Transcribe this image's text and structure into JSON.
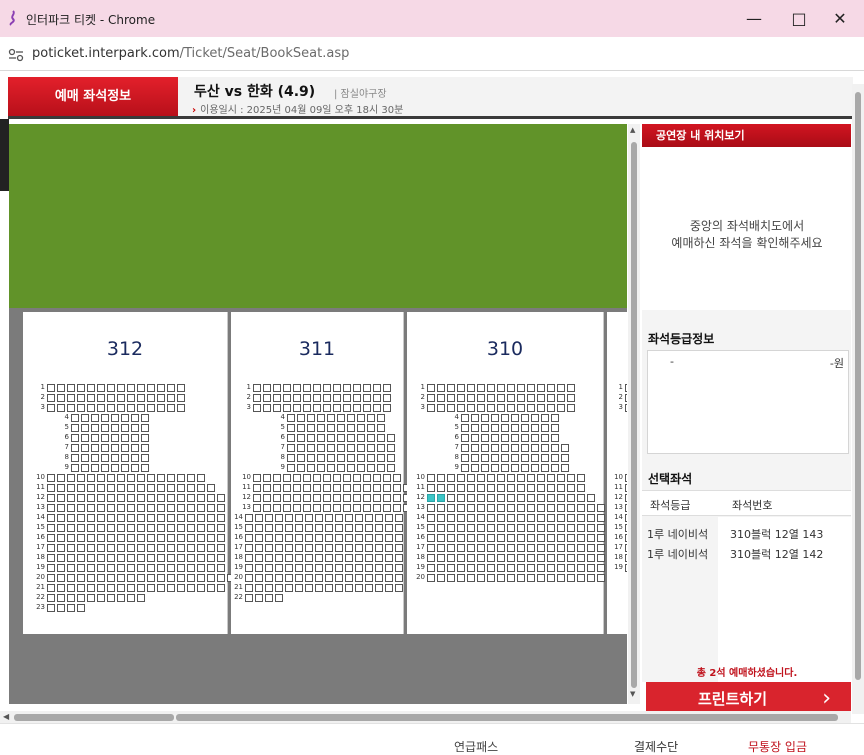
{
  "window": {
    "title": "인터파크 티켓 - Chrome",
    "url_domain": "poticket.interpark.com",
    "url_path": "/Ticket/Seat/BookSeat.asp"
  },
  "header": {
    "tab_label": "예매 좌석정보",
    "game_title": "두산 vs 한화 (4.9)",
    "venue": "| 잠실야구장",
    "datetime_label": "이용일시 : 2025년 04월 09일 오후 18시 30분"
  },
  "blocks": [
    {
      "name": "312",
      "rows": [
        {
          "num": "1",
          "seats": 14
        },
        {
          "num": "2",
          "seats": 14
        },
        {
          "num": "3",
          "seats": 14
        },
        {
          "num": "4",
          "seats": 8
        },
        {
          "num": "5",
          "seats": 8
        },
        {
          "num": "6",
          "seats": 8
        },
        {
          "num": "7",
          "seats": 8
        },
        {
          "num": "8",
          "seats": 8
        },
        {
          "num": "9",
          "seats": 8
        },
        {
          "num": "10",
          "seats": 16
        },
        {
          "num": "11",
          "seats": 17
        },
        {
          "num": "12",
          "seats": 18
        },
        {
          "num": "13",
          "seats": 18
        },
        {
          "num": "14",
          "seats": 18
        },
        {
          "num": "15",
          "seats": 18
        },
        {
          "num": "16",
          "seats": 18
        },
        {
          "num": "17",
          "seats": 18
        },
        {
          "num": "18",
          "seats": 18
        },
        {
          "num": "19",
          "seats": 18
        },
        {
          "num": "20",
          "seats": 19
        },
        {
          "num": "21",
          "seats": 18
        },
        {
          "num": "22",
          "seats": 10
        },
        {
          "num": "23",
          "seats": 4
        }
      ]
    },
    {
      "name": "311",
      "rows": [
        {
          "num": "1",
          "seats": 14
        },
        {
          "num": "2",
          "seats": 14
        },
        {
          "num": "3",
          "seats": 14
        },
        {
          "num": "4",
          "seats": 10
        },
        {
          "num": "5",
          "seats": 10
        },
        {
          "num": "6",
          "seats": 11
        },
        {
          "num": "7",
          "seats": 11
        },
        {
          "num": "8",
          "seats": 11
        },
        {
          "num": "9",
          "seats": 11
        },
        {
          "num": "10",
          "seats": 15
        },
        {
          "num": "11",
          "seats": 16
        },
        {
          "num": "12",
          "seats": 16
        },
        {
          "num": "13",
          "seats": 16
        },
        {
          "num": "14",
          "seats": 16
        },
        {
          "num": "15",
          "seats": 16
        },
        {
          "num": "16",
          "seats": 16
        },
        {
          "num": "17",
          "seats": 16
        },
        {
          "num": "18",
          "seats": 16
        },
        {
          "num": "19",
          "seats": 16
        },
        {
          "num": "20",
          "seats": 16
        },
        {
          "num": "21",
          "seats": 16
        },
        {
          "num": "22",
          "seats": 4
        }
      ]
    },
    {
      "name": "310",
      "rows": [
        {
          "num": "1",
          "seats": 15
        },
        {
          "num": "2",
          "seats": 15
        },
        {
          "num": "3",
          "seats": 15
        },
        {
          "num": "4",
          "seats": 10
        },
        {
          "num": "5",
          "seats": 10
        },
        {
          "num": "6",
          "seats": 10
        },
        {
          "num": "7",
          "seats": 11
        },
        {
          "num": "8",
          "seats": 11
        },
        {
          "num": "9",
          "seats": 11
        },
        {
          "num": "10",
          "seats": 16
        },
        {
          "num": "11",
          "seats": 16
        },
        {
          "num": "12",
          "seats": 17
        },
        {
          "num": "13",
          "seats": 18
        },
        {
          "num": "14",
          "seats": 18
        },
        {
          "num": "15",
          "seats": 18
        },
        {
          "num": "16",
          "seats": 18
        },
        {
          "num": "17",
          "seats": 18
        },
        {
          "num": "18",
          "seats": 18
        },
        {
          "num": "19",
          "seats": 18
        },
        {
          "num": "20",
          "seats": 18
        }
      ]
    },
    {
      "name": "",
      "rows": [
        {
          "num": "1",
          "seats": 1
        },
        {
          "num": "2",
          "seats": 1
        },
        {
          "num": "3",
          "seats": 1
        },
        {
          "num": "10",
          "seats": 1
        },
        {
          "num": "11",
          "seats": 1
        },
        {
          "num": "12",
          "seats": 1
        },
        {
          "num": "13",
          "seats": 1
        },
        {
          "num": "14",
          "seats": 1
        },
        {
          "num": "15",
          "seats": 1
        },
        {
          "num": "16",
          "seats": 1
        },
        {
          "num": "17",
          "seats": 1
        },
        {
          "num": "18",
          "seats": 1
        },
        {
          "num": "19",
          "seats": 1
        }
      ]
    }
  ],
  "selected_seats_map": [
    {
      "block": "310",
      "row": "12",
      "seat_index": 1
    },
    {
      "block": "310",
      "row": "12",
      "seat_index": 2
    }
  ],
  "right_panel": {
    "location_title": "공연장 내 위치보기",
    "location_msg_line1": "중앙의 좌석배치도에서",
    "location_msg_line2": "예매하신 좌석을 확인해주세요",
    "grade_title": "좌석등급정보",
    "grade_dash": "-",
    "grade_price": "-원",
    "selected_title": "선택좌석",
    "col_grade": "좌석등급",
    "col_seat": "좌석번호",
    "selected": [
      {
        "grade": "1루 네이비석",
        "seat": "310블럭 12열 143"
      },
      {
        "grade": "1루 네이비석",
        "seat": "310블럭 12열 142"
      }
    ],
    "total_msg": "총 2석 예매하셨습니다.",
    "print_button": "프린트하기",
    "print_arrow": "›"
  },
  "bottom": {
    "item1": "연급패스",
    "item2": "결제수단",
    "item3": "무통장 입금"
  },
  "colors": {
    "field": "#619329",
    "selected_seat": "#3cc6c8",
    "accent_red": "#d9242d"
  }
}
